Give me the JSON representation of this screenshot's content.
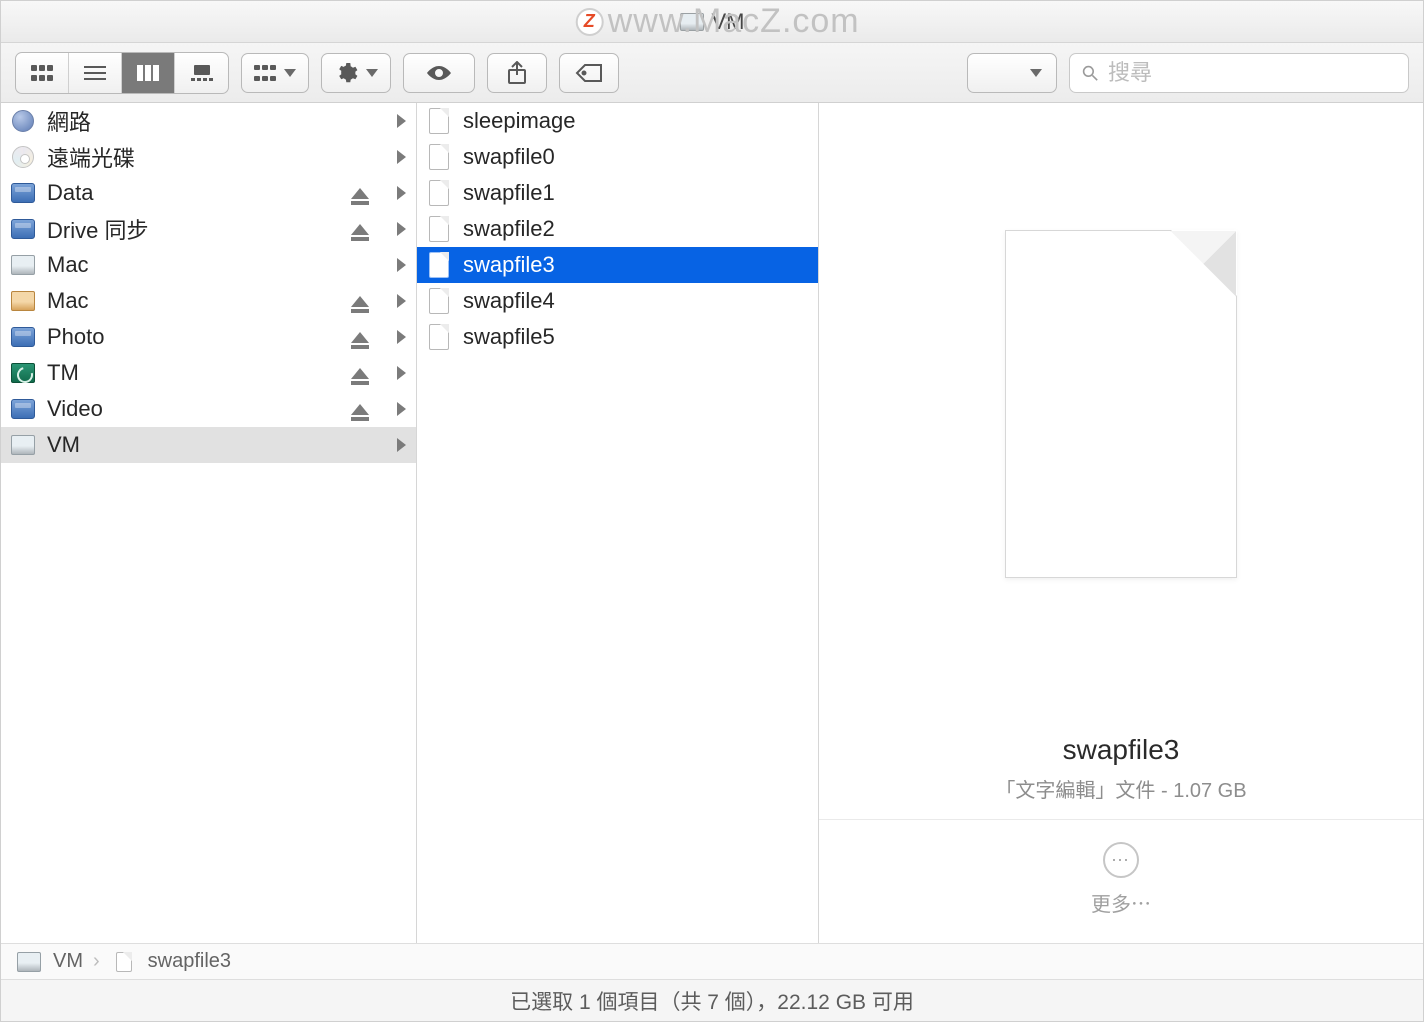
{
  "window": {
    "title": "VM"
  },
  "watermark": {
    "text": "www.MacZ.com",
    "badge": "Z"
  },
  "search": {
    "placeholder": "搜尋"
  },
  "sidebar": {
    "items": [
      {
        "icon": "globe",
        "label": "網路",
        "eject": false,
        "arrow": true
      },
      {
        "icon": "cd",
        "label": "遠端光碟",
        "eject": false,
        "arrow": true
      },
      {
        "icon": "drive-blue",
        "label": "Data",
        "eject": true,
        "arrow": true
      },
      {
        "icon": "drive-blue",
        "label": "Drive 同步",
        "eject": true,
        "arrow": true
      },
      {
        "icon": "drive-grey",
        "label": "Mac",
        "eject": false,
        "arrow": true
      },
      {
        "icon": "drive-orange",
        "label": "Mac",
        "eject": true,
        "arrow": true
      },
      {
        "icon": "drive-blue",
        "label": "Photo",
        "eject": true,
        "arrow": true
      },
      {
        "icon": "tm",
        "label": "TM",
        "eject": true,
        "arrow": true
      },
      {
        "icon": "drive-blue",
        "label": "Video",
        "eject": true,
        "arrow": true
      },
      {
        "icon": "drive-grey",
        "label": "VM",
        "eject": false,
        "arrow": true,
        "selected": true
      }
    ]
  },
  "files": {
    "items": [
      {
        "name": "sleepimage",
        "selected": false
      },
      {
        "name": "swapfile0",
        "selected": false
      },
      {
        "name": "swapfile1",
        "selected": false
      },
      {
        "name": "swapfile2",
        "selected": false
      },
      {
        "name": "swapfile3",
        "selected": true
      },
      {
        "name": "swapfile4",
        "selected": false
      },
      {
        "name": "swapfile5",
        "selected": false
      }
    ]
  },
  "preview": {
    "filename": "swapfile3",
    "subtitle": "「文字編輯」文件 - 1.07 GB",
    "more_label": "更多⋯"
  },
  "pathbar": {
    "segments": [
      {
        "icon": "drive-grey",
        "label": "VM"
      },
      {
        "icon": "file",
        "label": "swapfile3"
      }
    ]
  },
  "statusbar": {
    "text": "已選取 1 個項目（共 7 個），22.12 GB 可用"
  }
}
